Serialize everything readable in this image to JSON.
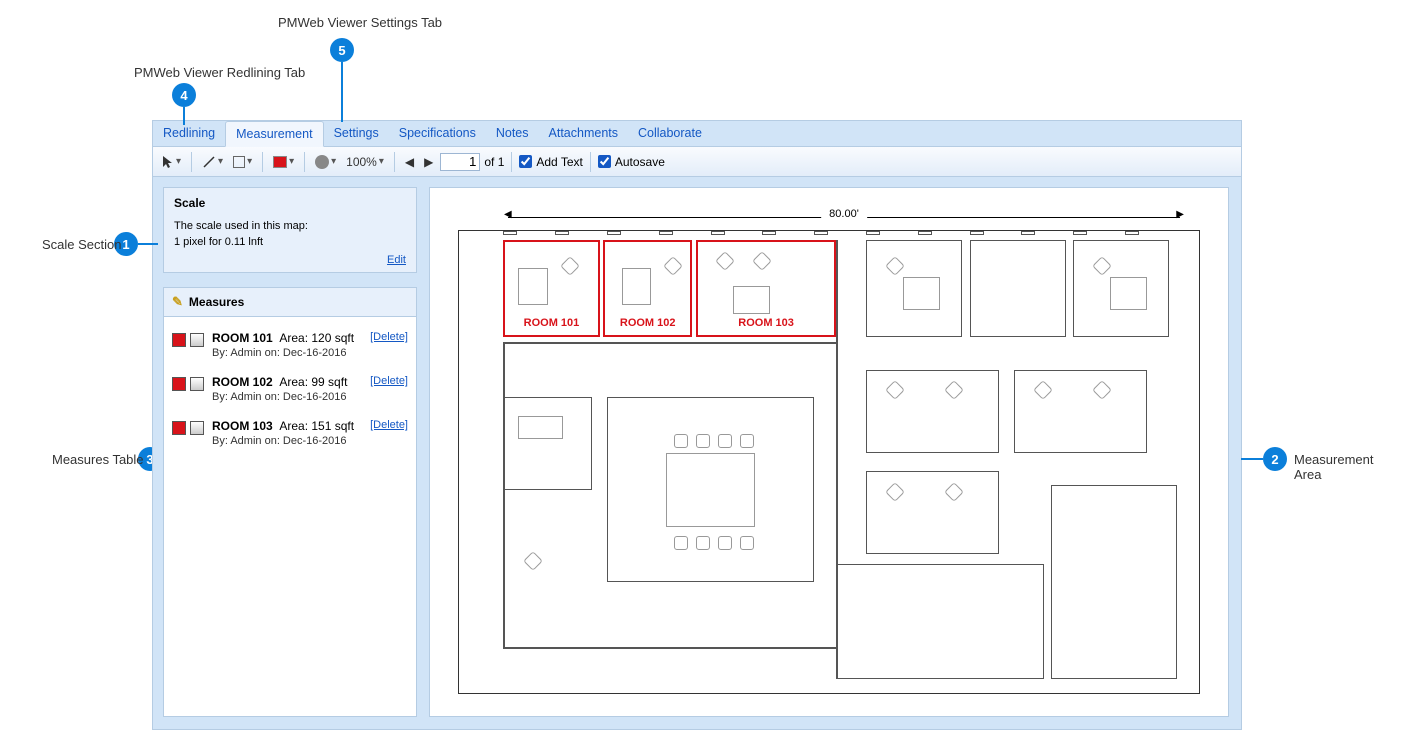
{
  "annotations": {
    "a1": "Scale Section",
    "a2": "Measurement Area",
    "a3": "Measures Table",
    "a4": "PMWeb Viewer Redlining Tab",
    "a5": "PMWeb Viewer Settings Tab"
  },
  "tabs": {
    "redlining": "Redlining",
    "measurement": "Measurement",
    "settings": "Settings",
    "specifications": "Specifications",
    "notes": "Notes",
    "attachments": "Attachments",
    "collaborate": "Collaborate"
  },
  "toolbar": {
    "zoom": "100%",
    "page_value": "1",
    "page_of": "of 1",
    "addtext": "Add Text",
    "autosave": "Autosave"
  },
  "scale": {
    "title": "Scale",
    "desc1": "The scale used in this map:",
    "desc2": "1 pixel for 0.11 lnft",
    "edit": "Edit"
  },
  "measures": {
    "title": "Measures",
    "items": [
      {
        "name": "ROOM 101",
        "area": "Area: 120  sqft",
        "by": "By: Admin on: Dec-16-2016",
        "delete": "[Delete]"
      },
      {
        "name": "ROOM 102",
        "area": "Area: 99  sqft",
        "by": "By: Admin on: Dec-16-2016",
        "delete": "[Delete]"
      },
      {
        "name": "ROOM 103",
        "area": "Area: 151  sqft",
        "by": "By: Admin on: Dec-16-2016",
        "delete": "[Delete]"
      }
    ]
  },
  "drawing": {
    "dimension": "80.00'",
    "rooms": [
      "ROOM 101",
      "ROOM 102",
      "ROOM 103"
    ]
  }
}
